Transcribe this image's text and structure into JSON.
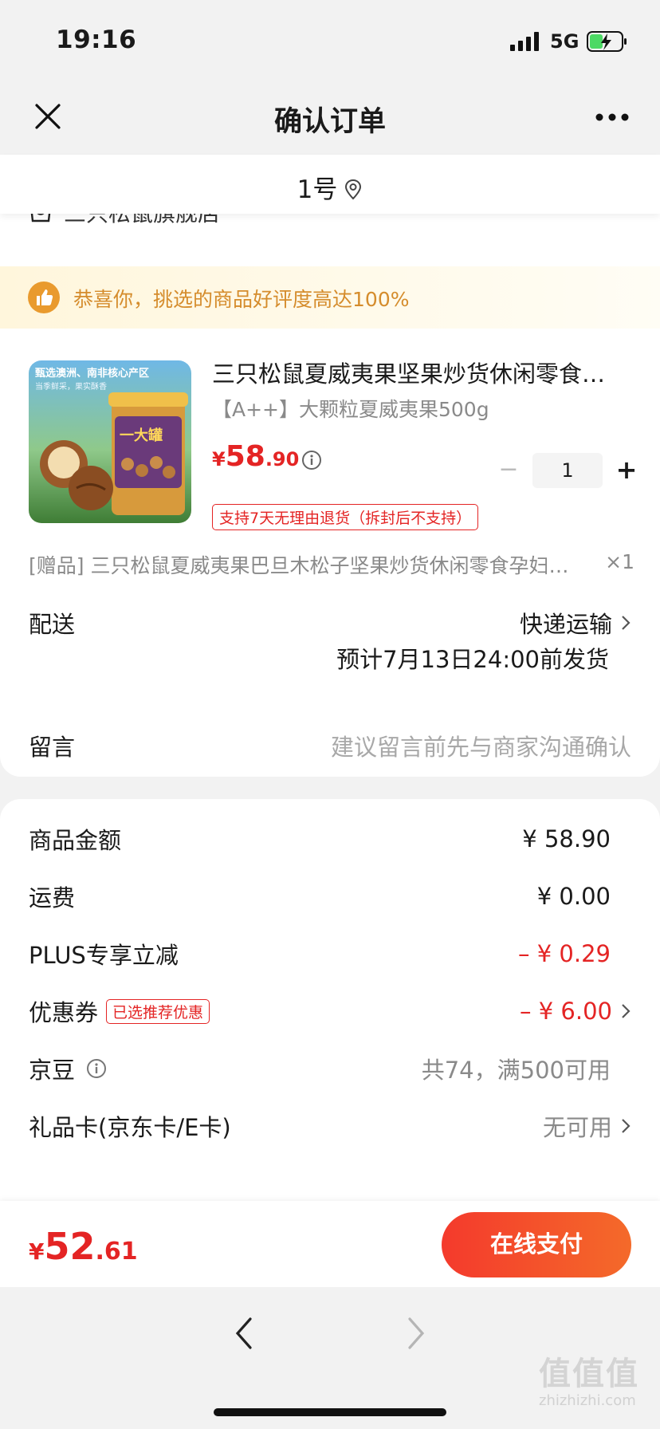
{
  "status": {
    "time": "19:16",
    "network": "5G"
  },
  "nav": {
    "title": "确认订单"
  },
  "address": {
    "text": "1号"
  },
  "store": {
    "name": "三只松鼠旗舰店"
  },
  "praise": {
    "text": "恭喜你，挑选的商品好评度高达100%"
  },
  "product": {
    "title": "三只松鼠夏威夷果坚果炒货休闲零食…",
    "spec": "【A++】大颗粒夏威夷果500g",
    "price_currency": "¥",
    "price_int": "58",
    "price_dec": ".90",
    "quantity": "1",
    "refund_tag": "支持7天无理由退货（拆封后不支持）",
    "image_text": {
      "headline": "甄选澳洲、南非核心产区",
      "sub": "当季鲜采，果实酥香",
      "jar_label": "一大罐"
    }
  },
  "gift": {
    "text": "[赠品] 三只松鼠夏威夷果巴旦木松子坚果炒货休闲零食孕妇…",
    "count": "×1"
  },
  "delivery": {
    "label": "配送",
    "value": "快递运输",
    "ship_time": "预计7月13日24:00前发货"
  },
  "message": {
    "label": "留言",
    "placeholder": "建议留言前先与商家沟通确认"
  },
  "fees": {
    "goods_label": "商品金额",
    "goods_value": "¥ 58.90",
    "shipping_label": "运费",
    "shipping_value": "¥ 0.00",
    "plus_label": "PLUS专享立减",
    "plus_value": "– ¥ 0.29",
    "coupon_label": "优惠券",
    "coupon_tag": "已选推荐优惠",
    "coupon_value": "– ¥ 6.00",
    "jingdou_label": "京豆",
    "jingdou_value": "共74，满500可用",
    "giftcard_label": "礼品卡(京东卡/E卡)",
    "giftcard_value": "无可用"
  },
  "pay": {
    "currency": "¥",
    "total_int": "52",
    "total_dec": ".61",
    "button": "在线支付"
  },
  "watermark": {
    "text": "值值值",
    "url": "zhizhizhi.com"
  },
  "colors": {
    "accent_red": "#e42424",
    "praise_orange": "#d58c2c"
  }
}
